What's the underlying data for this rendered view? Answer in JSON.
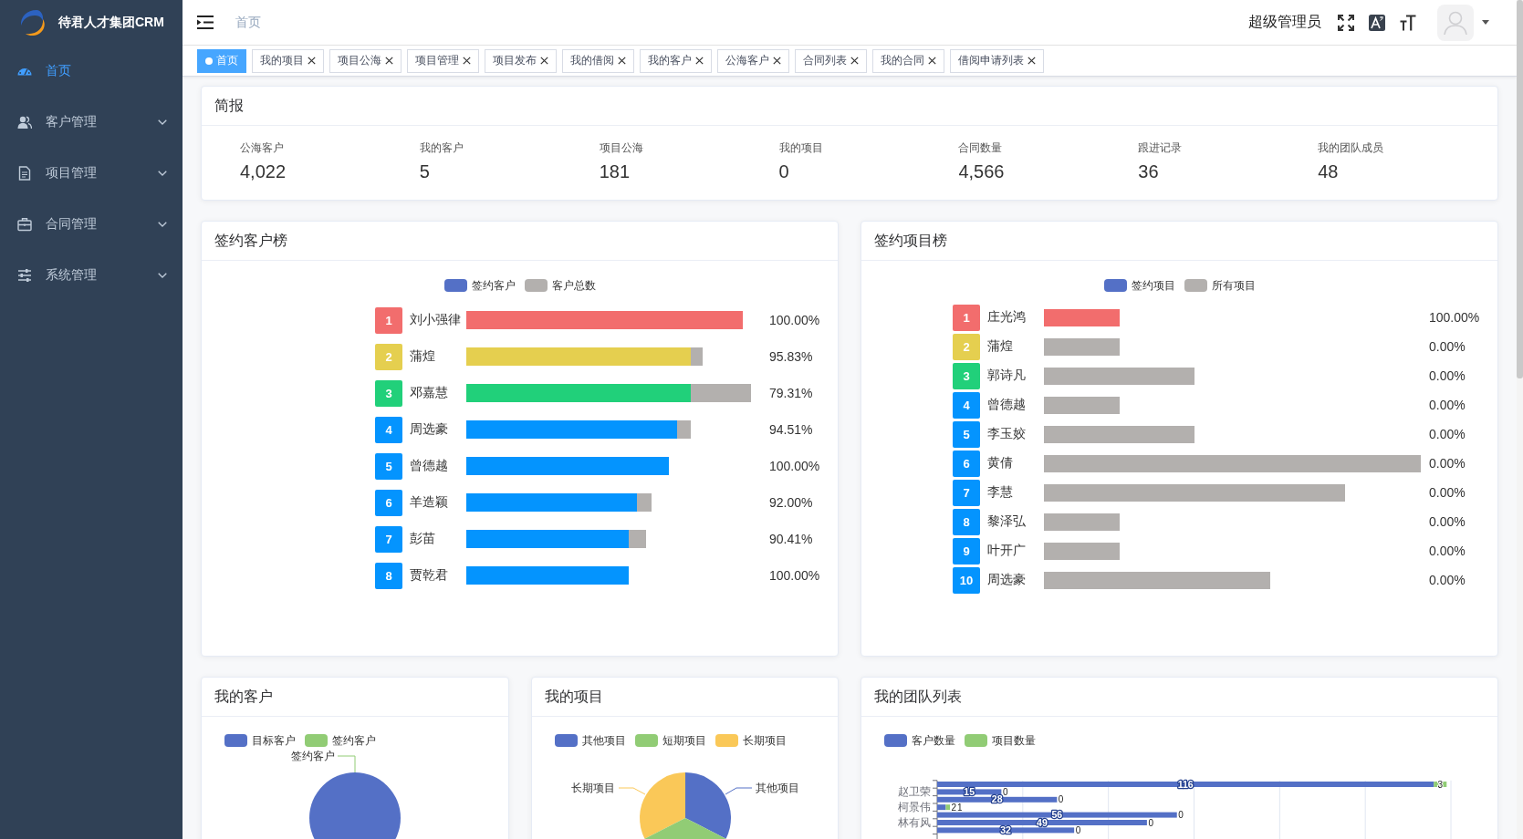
{
  "sidebar": {
    "logo_text": "待君人才集团CRM",
    "items": [
      {
        "label": "首页",
        "kind": "link",
        "selected": true
      },
      {
        "label": "客户管理",
        "kind": "submenu",
        "selected": false
      },
      {
        "label": "项目管理",
        "kind": "submenu",
        "selected": false
      },
      {
        "label": "合同管理",
        "kind": "submenu",
        "selected": false
      },
      {
        "label": "系统管理",
        "kind": "submenu",
        "selected": false
      }
    ]
  },
  "navbar": {
    "breadcrumb": "首页",
    "username": "超级管理员"
  },
  "tags": [
    {
      "label": "首页",
      "selected": true,
      "closable": false
    },
    {
      "label": "我的项目",
      "selected": false,
      "closable": true
    },
    {
      "label": "项目公海",
      "selected": false,
      "closable": true
    },
    {
      "label": "项目管理",
      "selected": false,
      "closable": true
    },
    {
      "label": "项目发布",
      "selected": false,
      "closable": true
    },
    {
      "label": "我的借阅",
      "selected": false,
      "closable": true
    },
    {
      "label": "我的客户",
      "selected": false,
      "closable": true
    },
    {
      "label": "公海客户",
      "selected": false,
      "closable": true
    },
    {
      "label": "合同列表",
      "selected": false,
      "closable": true
    },
    {
      "label": "我的合同",
      "selected": false,
      "closable": true
    },
    {
      "label": "借阅申请列表",
      "selected": false,
      "closable": true
    }
  ],
  "summary": {
    "title": "简报",
    "stats": [
      {
        "label": "公海客户",
        "value": "4,022"
      },
      {
        "label": "我的客户",
        "value": "5"
      },
      {
        "label": "项目公海",
        "value": "181"
      },
      {
        "label": "我的项目",
        "value": "0"
      },
      {
        "label": "合同数量",
        "value": "4,566"
      },
      {
        "label": "跟进记录",
        "value": "36"
      },
      {
        "label": "我的团队成员",
        "value": "48"
      }
    ]
  },
  "customer_ranking": {
    "title": "签约客户榜",
    "legend": [
      {
        "label": "签约客户",
        "color": "#5470c6"
      },
      {
        "label": "客户总数",
        "color": "#b3b0ae"
      }
    ],
    "rows": [
      {
        "rank": "1",
        "name": "刘小强律",
        "color": "#f26d6d",
        "percent": "100.00%"
      },
      {
        "rank": "2",
        "name": "蒲煌",
        "color": "#e5cf4f",
        "percent": "95.83%"
      },
      {
        "rank": "3",
        "name": "邓嘉慧",
        "color": "#21d07a",
        "percent": "79.31%"
      },
      {
        "rank": "4",
        "name": "周选豪",
        "color": "#0494fe",
        "percent": "94.51%"
      },
      {
        "rank": "5",
        "name": "曾德越",
        "color": "#0494fe",
        "percent": "100.00%"
      },
      {
        "rank": "6",
        "name": "羊造颖",
        "color": "#0494fe",
        "percent": "92.00%"
      },
      {
        "rank": "7",
        "name": "彭苗",
        "color": "#0494fe",
        "percent": "90.41%"
      },
      {
        "rank": "8",
        "name": "贾乾君",
        "color": "#0494fe",
        "percent": "100.00%"
      }
    ]
  },
  "project_ranking": {
    "title": "签约项目榜",
    "legend": [
      {
        "label": "签约项目",
        "color": "#5470c6"
      },
      {
        "label": "所有项目",
        "color": "#b3b0ae"
      }
    ],
    "rows": [
      {
        "rank": "1",
        "name": "庄光鸿",
        "color": "#f26d6d",
        "percent": "100.00%"
      },
      {
        "rank": "2",
        "name": "蒲煌",
        "color": "#e5cf4f",
        "percent": "0.00%"
      },
      {
        "rank": "3",
        "name": "郭诗凡",
        "color": "#21d07a",
        "percent": "0.00%"
      },
      {
        "rank": "4",
        "name": "曾德越",
        "color": "#0494fe",
        "percent": "0.00%"
      },
      {
        "rank": "5",
        "name": "李玉姣",
        "color": "#0494fe",
        "percent": "0.00%"
      },
      {
        "rank": "6",
        "name": "黄倩",
        "color": "#0494fe",
        "percent": "0.00%"
      },
      {
        "rank": "7",
        "name": "李慧",
        "color": "#0494fe",
        "percent": "0.00%"
      },
      {
        "rank": "8",
        "name": "黎泽弘",
        "color": "#0494fe",
        "percent": "0.00%"
      },
      {
        "rank": "9",
        "name": "叶开广",
        "color": "#0494fe",
        "percent": "0.00%"
      },
      {
        "rank": "10",
        "name": "周选豪",
        "color": "#0494fe",
        "percent": "0.00%"
      }
    ]
  },
  "my_customers": {
    "title": "我的客户",
    "legend": [
      {
        "label": "目标客户",
        "color": "#5470c6"
      },
      {
        "label": "签约客户",
        "color": "#91cc75"
      }
    ],
    "slice_labels": [
      "签约客户"
    ]
  },
  "my_projects": {
    "title": "我的项目",
    "legend": [
      {
        "label": "其他项目",
        "color": "#5470c6"
      },
      {
        "label": "短期项目",
        "color": "#91cc75"
      },
      {
        "label": "长期项目",
        "color": "#fac858"
      }
    ],
    "slice_labels": [
      "长期项目",
      "其他项目"
    ]
  },
  "team": {
    "title": "我的团队列表",
    "chart_data": {
      "type": "bar",
      "orientation": "horizontal",
      "stacked": true,
      "categories": [
        null,
        "赵卫荣",
        null,
        "柯景伟",
        null,
        "林有风",
        null
      ],
      "series": [
        {
          "name": "客户数量",
          "color": "#5470c6",
          "values": [
            116,
            15,
            28,
            2,
            56,
            49,
            32
          ]
        },
        {
          "name": "项目数量",
          "color": "#91cc75",
          "values": [
            3,
            0,
            0,
            1,
            0,
            0,
            0
          ]
        }
      ],
      "xlim": [
        0,
        120
      ],
      "data_labels": true
    }
  }
}
